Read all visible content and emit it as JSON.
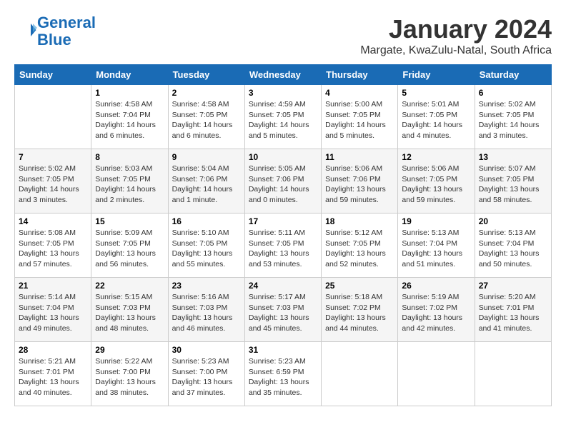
{
  "logo": {
    "line1": "General",
    "line2": "Blue"
  },
  "title": "January 2024",
  "location": "Margate, KwaZulu-Natal, South Africa",
  "weekdays": [
    "Sunday",
    "Monday",
    "Tuesday",
    "Wednesday",
    "Thursday",
    "Friday",
    "Saturday"
  ],
  "weeks": [
    [
      {
        "day": "",
        "info": ""
      },
      {
        "day": "1",
        "info": "Sunrise: 4:58 AM\nSunset: 7:04 PM\nDaylight: 14 hours\nand 6 minutes."
      },
      {
        "day": "2",
        "info": "Sunrise: 4:58 AM\nSunset: 7:05 PM\nDaylight: 14 hours\nand 6 minutes."
      },
      {
        "day": "3",
        "info": "Sunrise: 4:59 AM\nSunset: 7:05 PM\nDaylight: 14 hours\nand 5 minutes."
      },
      {
        "day": "4",
        "info": "Sunrise: 5:00 AM\nSunset: 7:05 PM\nDaylight: 14 hours\nand 5 minutes."
      },
      {
        "day": "5",
        "info": "Sunrise: 5:01 AM\nSunset: 7:05 PM\nDaylight: 14 hours\nand 4 minutes."
      },
      {
        "day": "6",
        "info": "Sunrise: 5:02 AM\nSunset: 7:05 PM\nDaylight: 14 hours\nand 3 minutes."
      }
    ],
    [
      {
        "day": "7",
        "info": "Sunrise: 5:02 AM\nSunset: 7:05 PM\nDaylight: 14 hours\nand 3 minutes."
      },
      {
        "day": "8",
        "info": "Sunrise: 5:03 AM\nSunset: 7:05 PM\nDaylight: 14 hours\nand 2 minutes."
      },
      {
        "day": "9",
        "info": "Sunrise: 5:04 AM\nSunset: 7:06 PM\nDaylight: 14 hours\nand 1 minute."
      },
      {
        "day": "10",
        "info": "Sunrise: 5:05 AM\nSunset: 7:06 PM\nDaylight: 14 hours\nand 0 minutes."
      },
      {
        "day": "11",
        "info": "Sunrise: 5:06 AM\nSunset: 7:06 PM\nDaylight: 13 hours\nand 59 minutes."
      },
      {
        "day": "12",
        "info": "Sunrise: 5:06 AM\nSunset: 7:05 PM\nDaylight: 13 hours\nand 59 minutes."
      },
      {
        "day": "13",
        "info": "Sunrise: 5:07 AM\nSunset: 7:05 PM\nDaylight: 13 hours\nand 58 minutes."
      }
    ],
    [
      {
        "day": "14",
        "info": "Sunrise: 5:08 AM\nSunset: 7:05 PM\nDaylight: 13 hours\nand 57 minutes."
      },
      {
        "day": "15",
        "info": "Sunrise: 5:09 AM\nSunset: 7:05 PM\nDaylight: 13 hours\nand 56 minutes."
      },
      {
        "day": "16",
        "info": "Sunrise: 5:10 AM\nSunset: 7:05 PM\nDaylight: 13 hours\nand 55 minutes."
      },
      {
        "day": "17",
        "info": "Sunrise: 5:11 AM\nSunset: 7:05 PM\nDaylight: 13 hours\nand 53 minutes."
      },
      {
        "day": "18",
        "info": "Sunrise: 5:12 AM\nSunset: 7:05 PM\nDaylight: 13 hours\nand 52 minutes."
      },
      {
        "day": "19",
        "info": "Sunrise: 5:13 AM\nSunset: 7:04 PM\nDaylight: 13 hours\nand 51 minutes."
      },
      {
        "day": "20",
        "info": "Sunrise: 5:13 AM\nSunset: 7:04 PM\nDaylight: 13 hours\nand 50 minutes."
      }
    ],
    [
      {
        "day": "21",
        "info": "Sunrise: 5:14 AM\nSunset: 7:04 PM\nDaylight: 13 hours\nand 49 minutes."
      },
      {
        "day": "22",
        "info": "Sunrise: 5:15 AM\nSunset: 7:03 PM\nDaylight: 13 hours\nand 48 minutes."
      },
      {
        "day": "23",
        "info": "Sunrise: 5:16 AM\nSunset: 7:03 PM\nDaylight: 13 hours\nand 46 minutes."
      },
      {
        "day": "24",
        "info": "Sunrise: 5:17 AM\nSunset: 7:03 PM\nDaylight: 13 hours\nand 45 minutes."
      },
      {
        "day": "25",
        "info": "Sunrise: 5:18 AM\nSunset: 7:02 PM\nDaylight: 13 hours\nand 44 minutes."
      },
      {
        "day": "26",
        "info": "Sunrise: 5:19 AM\nSunset: 7:02 PM\nDaylight: 13 hours\nand 42 minutes."
      },
      {
        "day": "27",
        "info": "Sunrise: 5:20 AM\nSunset: 7:01 PM\nDaylight: 13 hours\nand 41 minutes."
      }
    ],
    [
      {
        "day": "28",
        "info": "Sunrise: 5:21 AM\nSunset: 7:01 PM\nDaylight: 13 hours\nand 40 minutes."
      },
      {
        "day": "29",
        "info": "Sunrise: 5:22 AM\nSunset: 7:00 PM\nDaylight: 13 hours\nand 38 minutes."
      },
      {
        "day": "30",
        "info": "Sunrise: 5:23 AM\nSunset: 7:00 PM\nDaylight: 13 hours\nand 37 minutes."
      },
      {
        "day": "31",
        "info": "Sunrise: 5:23 AM\nSunset: 6:59 PM\nDaylight: 13 hours\nand 35 minutes."
      },
      {
        "day": "",
        "info": ""
      },
      {
        "day": "",
        "info": ""
      },
      {
        "day": "",
        "info": ""
      }
    ]
  ]
}
